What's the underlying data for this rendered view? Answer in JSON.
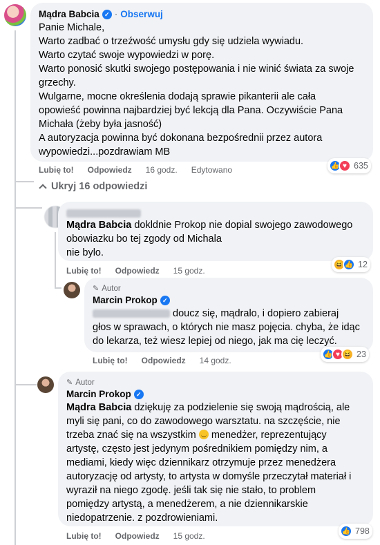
{
  "comments": {
    "main": {
      "author": "Mądra Babcia",
      "follow": "Obserwuj",
      "lines": [
        "Panie Michale,",
        "Warto zadbać o trzeźwość umysłu gdy się udziela wywiadu.",
        "Warto czytać swoje wypowiedzi w porę.",
        "Warto ponosić skutki swojego postępowania i nie winić świata za swoje",
        "grzechy.",
        "Wulgarne, mocne określenia dodają sprawie pikanterii ale cała",
        "opowieść powinna najbardziej być lekcją dla Pana. Oczywiście Pana",
        "Michała (żeby była jasność)",
        "A autoryzacja powinna być dokonana bezpośrednii przez autora",
        "wypowiedzi...pozdrawiam MB"
      ],
      "like": "Lubię to!",
      "reply": "Odpowiedz",
      "time": "16 godz.",
      "edited": "Edytowano",
      "reaction_count": "635"
    },
    "hide_replies": "Ukryj 16 odpowiedzi",
    "reply1": {
      "mention": "Mądra Babcia",
      "line1": " dokldnie Prokop nie dopial swojego zawodowego",
      "line2": "obowiazku bo tej zgody od Michala",
      "line3": "nie bylo.",
      "like": "Lubię to!",
      "reply": "Odpowiedz",
      "time": "15 godz.",
      "reaction_count": "12"
    },
    "reply2": {
      "tag": "Autor",
      "author": "Marcin Prokop",
      "line1": " doucz się, mądralo, i dopiero zabieraj",
      "line2": "głos w sprawach, o których nie masz pojęcia. chyba, że idąc",
      "line3": "do lekarza, też wiesz lepiej od niego, jak ma cię leczyć.",
      "like": "Lubię to!",
      "reply": "Odpowiedz",
      "time": "14 godz.",
      "reaction_count": "23"
    },
    "reply3": {
      "tag": "Autor",
      "author": "Marcin Prokop",
      "mention": "Mądra Babcia",
      "line1": " dziękuję za podzielenie się swoją mądrością, ale",
      "line2": "myli się pani, co do zawodowego warsztatu. na szczęście, nie",
      "line3a": "trzeba znać się na wszystkim ",
      "line3b": " menedżer, reprezentujący",
      "line4": "artystę, często jest jedynym pośrednikiem pomiędzy nim, a",
      "line5": "mediami, kiedy więc dziennikarz otrzymuje przez menedżera",
      "line6": "autoryzację od artysty, to artysta w domyśle przeczytał materiał i",
      "line7": "wyraził na niego zgodę. jeśli tak się nie stało, to problem",
      "line8": "pomiędzy artystą, a menedżerem, a nie dziennikarskie",
      "line9": "niedopatrzenie. z pozdrowieniami.",
      "like": "Lubię to!",
      "reply": "Odpowiedz",
      "time": "15 godz.",
      "reaction_count": "798"
    }
  },
  "colors": {
    "link_blue": "#1877f2",
    "bubble_bg": "#f0f2f5",
    "meta_gray": "#65676b"
  }
}
